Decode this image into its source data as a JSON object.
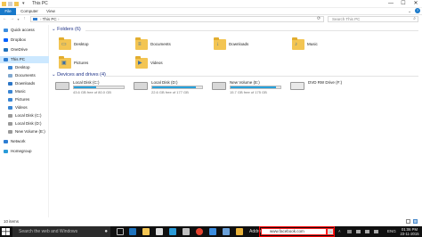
{
  "window": {
    "title": "This PC",
    "controls": {
      "minimize": "—",
      "maximize": "☐",
      "close": "✕"
    }
  },
  "ribbon": {
    "tabs": [
      "File",
      "Computer",
      "View"
    ]
  },
  "address_bar": {
    "back": "←",
    "forward": "→",
    "up": "↑",
    "path": "This PC",
    "search_placeholder": "Search This PC"
  },
  "sidebar": {
    "items": [
      {
        "label": "Quick access",
        "icon": "star-icon",
        "color": "#3b8de0"
      },
      {
        "label": "Dropbox",
        "icon": "dropbox-icon",
        "color": "#0061fe"
      },
      {
        "label": "OneDrive",
        "icon": "cloud-icon",
        "color": "#1e73be"
      },
      {
        "label": "This PC",
        "icon": "computer-icon",
        "color": "#2d7dd2"
      },
      {
        "label": "Desktop",
        "icon": "desktop-icon",
        "color": "#3a86d4"
      },
      {
        "label": "Documents",
        "icon": "documents-icon",
        "color": "#7fa7cf"
      },
      {
        "label": "Downloads",
        "icon": "downloads-icon",
        "color": "#2c76c6"
      },
      {
        "label": "Music",
        "icon": "music-icon",
        "color": "#3a86d4"
      },
      {
        "label": "Pictures",
        "icon": "pictures-icon",
        "color": "#3a86d4"
      },
      {
        "label": "Videos",
        "icon": "videos-icon",
        "color": "#3a86d4"
      },
      {
        "label": "Local Disk (C:)",
        "icon": "drive-icon",
        "color": "#9a9a9a"
      },
      {
        "label": "Local Disk (D:)",
        "icon": "drive-icon",
        "color": "#9a9a9a"
      },
      {
        "label": "New Volume (E:)",
        "icon": "drive-icon",
        "color": "#9a9a9a"
      },
      {
        "label": "Network",
        "icon": "network-icon",
        "color": "#2d7dd2"
      },
      {
        "label": "Homegroup",
        "icon": "homegroup-icon",
        "color": "#2a9bd8"
      }
    ]
  },
  "folders_group": {
    "title": "Folders (6)",
    "items": [
      {
        "label": "Desktop",
        "glyph": "▭"
      },
      {
        "label": "Documents",
        "glyph": "≡"
      },
      {
        "label": "Downloads",
        "glyph": "↓"
      },
      {
        "label": "Music",
        "glyph": "♪"
      },
      {
        "label": "Pictures",
        "glyph": "▣"
      },
      {
        "label": "Videos",
        "glyph": "▶"
      }
    ]
  },
  "drives_group": {
    "title": "Devices and drives (4)",
    "items": [
      {
        "name": "Local Disk (C:)",
        "free": "43.6 GB free of 80.0 GB",
        "fill": 0.45
      },
      {
        "name": "Local Disk (D:)",
        "free": "22.6 GB free of 177 GB",
        "fill": 0.87
      },
      {
        "name": "New Volume (E:)",
        "free": "15.7 GB free of 175 GB",
        "fill": 0.91
      },
      {
        "name": "DVD RW Drive (F:)",
        "free": "",
        "fill": null
      }
    ]
  },
  "status": {
    "count": "10 items"
  },
  "taskbar": {
    "search_placeholder": "Search the web and Windows",
    "address_label": "Address",
    "address_value": "www.facebook.com",
    "go_glyph": "→",
    "language": "ENG",
    "time": "01:06 PM",
    "date": "23-11-2015"
  }
}
